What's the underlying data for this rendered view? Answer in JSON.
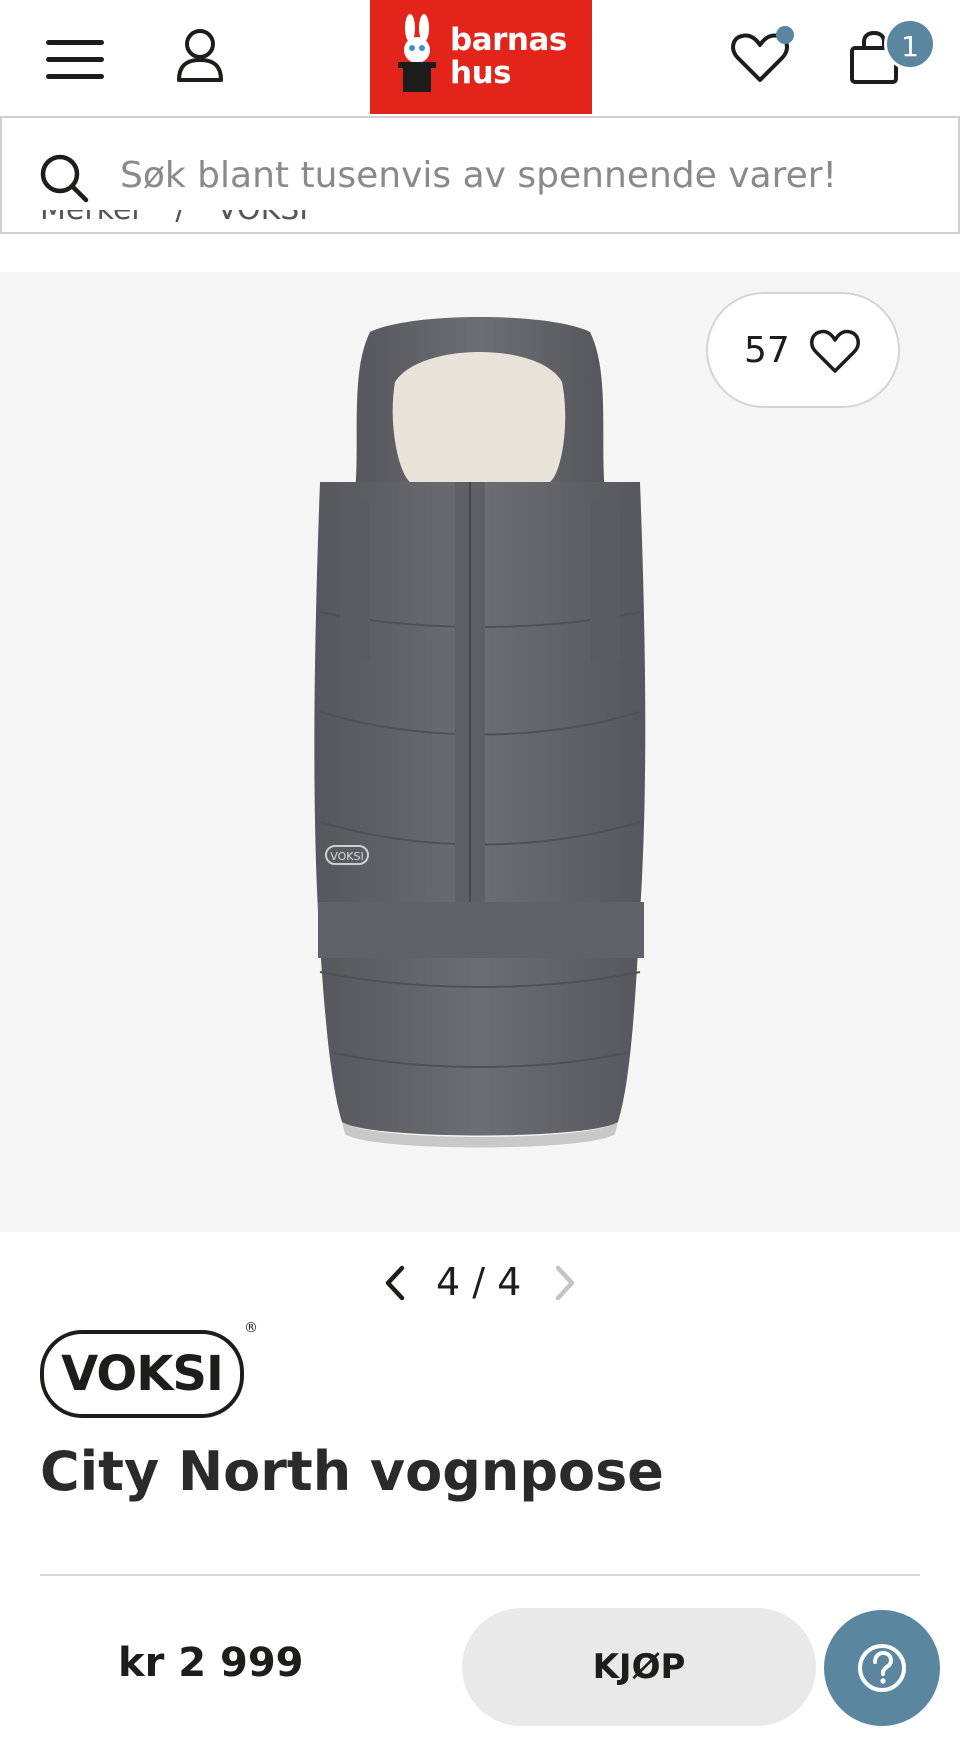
{
  "header": {
    "logo_line1": "barnas",
    "logo_line2": "hus",
    "cart_count": "1",
    "brand_color": "#e3241b",
    "accent_color": "#5b86a0"
  },
  "search": {
    "placeholder": "Søk blant tusenvis av spennende varer!"
  },
  "breadcrumb": {
    "items": [
      "Merker",
      "/",
      "VOKSI"
    ]
  },
  "gallery": {
    "like_count": "57",
    "pager": "4 / 4"
  },
  "product": {
    "brand": "VOKSI",
    "brand_reg": "®",
    "title": "City North vognpose",
    "image_logo": "VOKSI"
  },
  "bottom_bar": {
    "price": "kr 2 999",
    "buy_label": "KJØP"
  },
  "icons": [
    "menu-icon",
    "account-icon",
    "heart-icon",
    "cart-icon",
    "search-icon",
    "chevron-left-icon",
    "chevron-right-icon",
    "question-icon"
  ]
}
